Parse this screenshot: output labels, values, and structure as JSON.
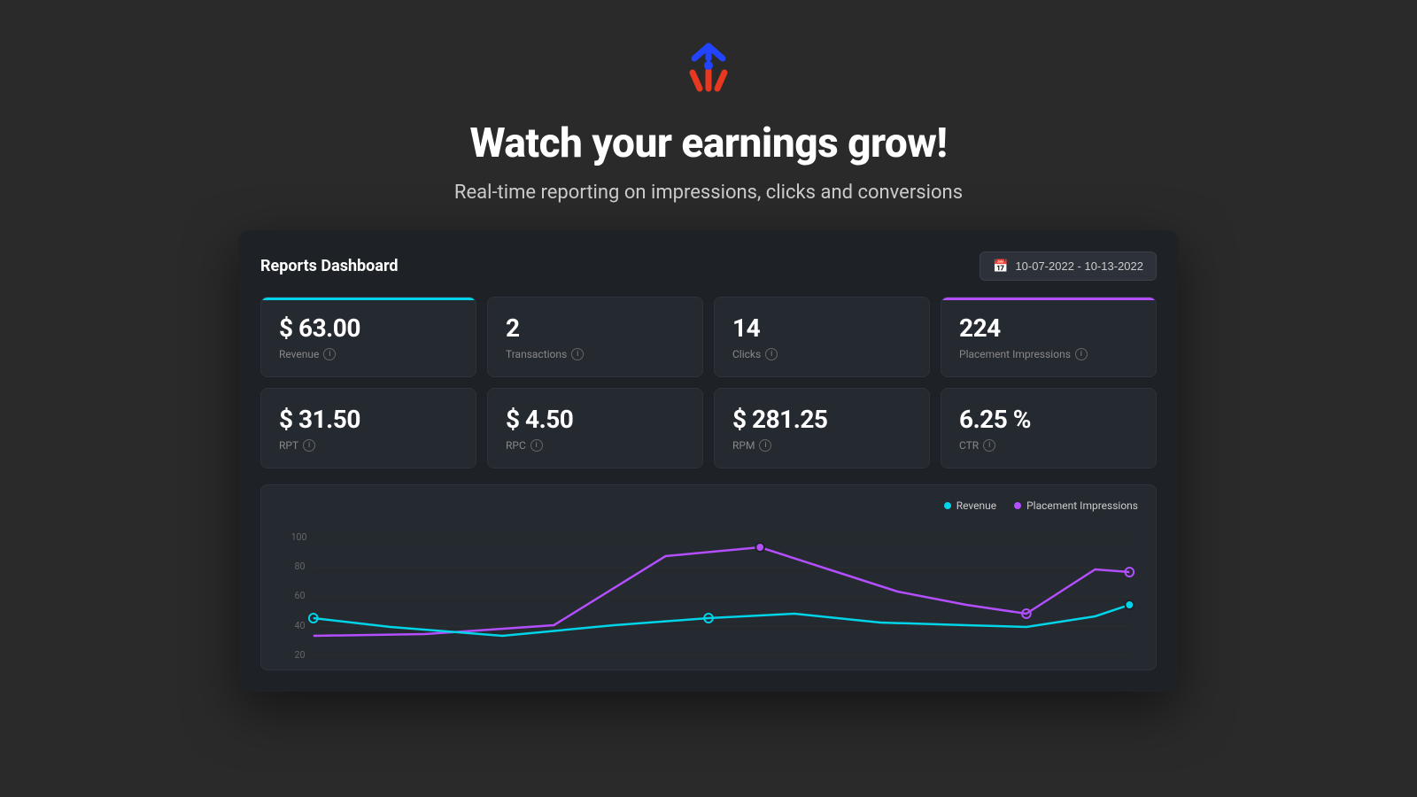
{
  "hero": {
    "title": "Watch your earnings grow!",
    "subtitle": "Real-time reporting on impressions, clicks and conversions"
  },
  "dashboard": {
    "title": "Reports Dashboard",
    "date_range": "10-07-2022 - 10-13-2022",
    "metrics_top": [
      {
        "id": "revenue",
        "value": "$ 63.00",
        "label": "Revenue",
        "highlight": "cyan"
      },
      {
        "id": "transactions",
        "value": "2",
        "label": "Transactions",
        "highlight": "none"
      },
      {
        "id": "clicks",
        "value": "14",
        "label": "Clicks",
        "highlight": "none"
      },
      {
        "id": "placement-impressions",
        "value": "224",
        "label": "Placement Impressions",
        "highlight": "magenta"
      }
    ],
    "metrics_bottom": [
      {
        "id": "rpt",
        "value": "$ 31.50",
        "label": "RPT"
      },
      {
        "id": "rpc",
        "value": "$ 4.50",
        "label": "RPC"
      },
      {
        "id": "rpm",
        "value": "$ 281.25",
        "label": "RPM"
      },
      {
        "id": "ctr",
        "value": "6.25 %",
        "label": "CTR"
      }
    ],
    "chart": {
      "legend": [
        {
          "id": "revenue",
          "label": "Revenue",
          "color": "cyan"
        },
        {
          "id": "placement-impressions",
          "label": "Placement Impressions",
          "color": "magenta"
        }
      ],
      "y_axis_labels": [
        "20",
        "40",
        "60",
        "80",
        "100"
      ]
    }
  }
}
